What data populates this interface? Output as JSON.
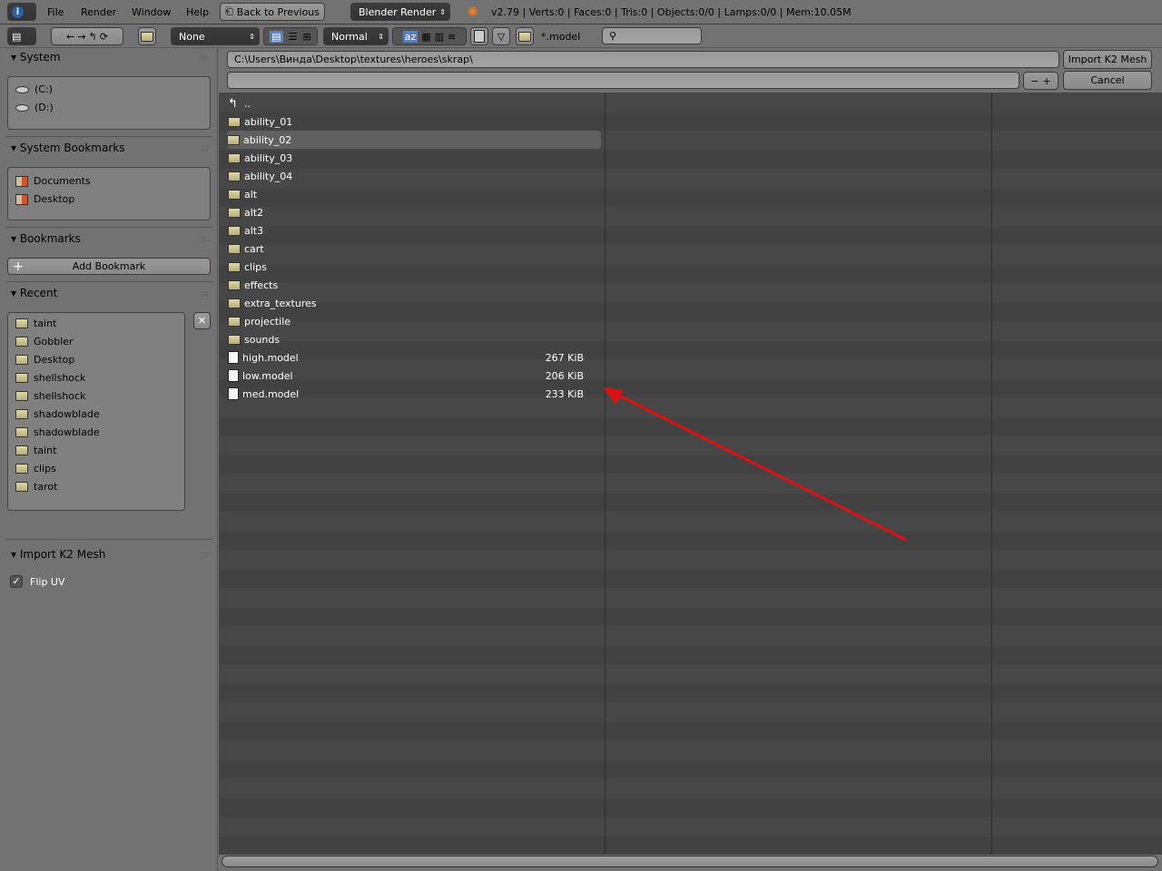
{
  "topbar": {
    "menus": [
      "File",
      "Render",
      "Window",
      "Help"
    ],
    "back_label": "Back to Previous",
    "engine": "Blender Render",
    "stats": "v2.79 | Verts:0 | Faces:0 | Tris:0 | Objects:0/0 | Lamps:0/0 | Mem:10.05M"
  },
  "toolbar": {
    "recursion": "None",
    "display": "Normal",
    "filter": "*.model",
    "search_placeholder": ""
  },
  "path": {
    "directory": "C:\\Users\\Винда\\Desktop\\textures\\heroes\\skrap\\",
    "filename": "",
    "import_label": "Import K2 Mesh",
    "cancel_label": "Cancel"
  },
  "sidebar": {
    "system": {
      "title": "System",
      "items": [
        "(C:)",
        "(D:)"
      ]
    },
    "system_bookmarks": {
      "title": "System Bookmarks",
      "items": [
        "Documents",
        "Desktop"
      ]
    },
    "bookmarks": {
      "title": "Bookmarks",
      "add_label": "Add Bookmark"
    },
    "recent": {
      "title": "Recent",
      "items": [
        "taint",
        "Gobbler",
        "Desktop",
        "shellshock",
        "shellshock",
        "shadowblade",
        "shadowblade",
        "taint",
        "clips",
        "tarot"
      ]
    },
    "operator": {
      "title": "Import K2 Mesh",
      "flip_uv_label": "Flip UV",
      "flip_uv": true
    }
  },
  "files": {
    "parent": "..",
    "selected_index": 1,
    "entries": [
      {
        "name": "ability_01",
        "type": "folder",
        "size": ""
      },
      {
        "name": "ability_02",
        "type": "folder",
        "size": ""
      },
      {
        "name": "ability_03",
        "type": "folder",
        "size": ""
      },
      {
        "name": "ability_04",
        "type": "folder",
        "size": ""
      },
      {
        "name": "alt",
        "type": "folder",
        "size": ""
      },
      {
        "name": "alt2",
        "type": "folder",
        "size": ""
      },
      {
        "name": "alt3",
        "type": "folder",
        "size": ""
      },
      {
        "name": "cart",
        "type": "folder",
        "size": ""
      },
      {
        "name": "clips",
        "type": "folder",
        "size": ""
      },
      {
        "name": "effects",
        "type": "folder",
        "size": ""
      },
      {
        "name": "extra_textures",
        "type": "folder",
        "size": ""
      },
      {
        "name": "projectile",
        "type": "folder",
        "size": ""
      },
      {
        "name": "sounds",
        "type": "folder",
        "size": ""
      },
      {
        "name": "high.model",
        "type": "file",
        "size": "267 KiB"
      },
      {
        "name": "low.model",
        "type": "file",
        "size": "206 KiB"
      },
      {
        "name": "med.model",
        "type": "file",
        "size": "233 KiB"
      }
    ]
  },
  "annotation": {
    "color": "#e01010"
  }
}
